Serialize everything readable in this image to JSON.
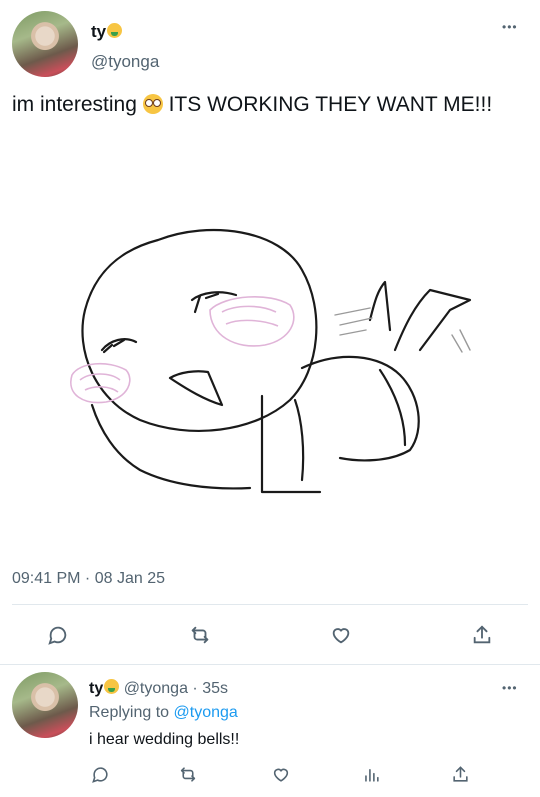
{
  "main_tweet": {
    "display_name": "ty",
    "name_emoji": "money-mouth-face",
    "handle": "@tyonga",
    "text_before": "im interesting",
    "text_emoji": "flushed-face",
    "text_after": "ITS WORKING THEY WANT ME!!!",
    "timestamp": "09:41 PM · 08 Jan 25",
    "more_label": "•••"
  },
  "reply_tweet": {
    "display_name": "ty",
    "name_emoji": "money-mouth-face",
    "handle": "@tyonga",
    "time": "· 35s",
    "replying_prefix": "Replying to",
    "replying_handle": "@tyonga",
    "text": "i hear wedding bells!!",
    "more_label": "•••"
  },
  "icons": [
    "reply-icon",
    "retweet-icon",
    "like-icon",
    "views-icon",
    "share-icon"
  ],
  "colors": {
    "text": "#0f1419",
    "secondary": "#536471",
    "link": "#1d9bf0",
    "divider": "#e1e8ed",
    "blush": "#e0b4d8"
  }
}
